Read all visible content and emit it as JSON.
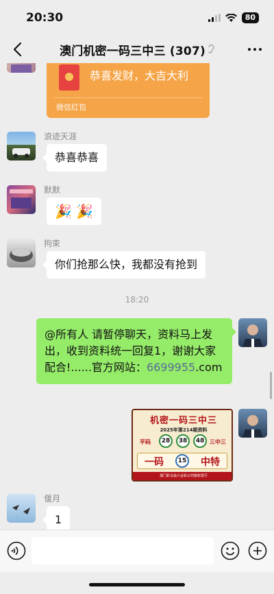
{
  "status_bar": {
    "time": "20:30",
    "battery": "80",
    "signal_icon": "cellular-signal-icon",
    "wifi_icon": "wifi-icon"
  },
  "nav": {
    "title": "澳门机密一码三中三 (307)",
    "ear_icon": "ear-icon",
    "back_icon": "chevron-left-icon",
    "more_icon": "more-dots-icon"
  },
  "messages": {
    "redpacket": {
      "text": "恭喜发财，大吉大利",
      "label": "微信红包"
    },
    "msg1": {
      "sender": "浪迹天涯",
      "text": "恭喜恭喜"
    },
    "msg2": {
      "sender": "默默",
      "emoji": "🎉 🎉"
    },
    "msg3": {
      "sender": "拘束",
      "text": "你们抢那么快，我都没有抢到"
    },
    "timestamp": "18:20",
    "msg4": {
      "line1": "@所有人 请暂停聊天，资料马上发",
      "line2": "出，收到资料统一回复1，谢谢大家",
      "line3_prefix": "配合!......官方网站：",
      "line3_link": "6699955",
      "line3_suffix": ".com"
    },
    "poster": {
      "title": "机密一码三中三",
      "subtitle": "2025年第214期资料",
      "left_label": "平码",
      "right_label": "三中三",
      "balls": [
        "28",
        "38",
        "48"
      ],
      "band_left": "一码",
      "special_ball": "15",
      "band_right": "中特",
      "footer": "澳门彩马会六合彩公司版权发行"
    },
    "msg5": {
      "sender": "偃月",
      "text": "1"
    }
  },
  "input_bar": {
    "voice_icon": "voice-icon",
    "emoji_icon": "emoji-smile-icon",
    "plus_icon": "plus-circle-icon"
  },
  "colors": {
    "chat_bg": "#ededed",
    "own_bubble": "#95ec69",
    "redpacket": "#f5a447",
    "link": "#576b95"
  }
}
